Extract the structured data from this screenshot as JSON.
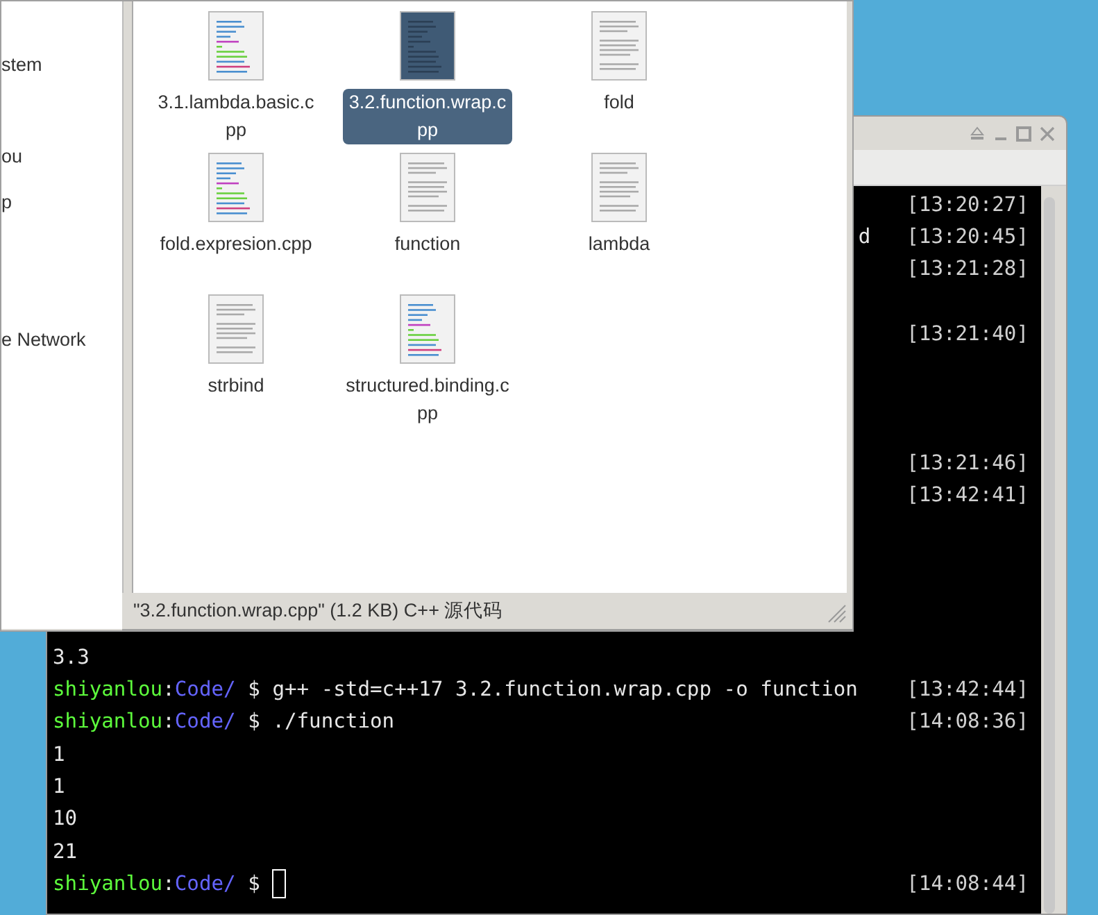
{
  "file_manager": {
    "sidebar": {
      "items": [
        {
          "kind": "place",
          "label": "stem"
        },
        {
          "kind": "blank"
        },
        {
          "kind": "place",
          "label": "ou"
        },
        {
          "kind": "place",
          "label": "p"
        },
        {
          "kind": "blank"
        },
        {
          "kind": "blank"
        },
        {
          "kind": "place",
          "label": "e Network"
        }
      ]
    },
    "files": [
      {
        "name": "3.1.lambda.basic.cpp",
        "kind": "code",
        "selected": false
      },
      {
        "name": "3.2.function.wrap.cpp",
        "kind": "code",
        "selected": true
      },
      {
        "name": "fold",
        "kind": "text",
        "selected": false
      },
      {
        "name": "fold.expresion.cpp",
        "kind": "code",
        "selected": false
      },
      {
        "name": "function",
        "kind": "text",
        "selected": false
      },
      {
        "name": "lambda",
        "kind": "text",
        "selected": false
      },
      {
        "name": "strbind",
        "kind": "text",
        "selected": false
      },
      {
        "name": "structured.binding.cpp",
        "kind": "code",
        "selected": false
      }
    ],
    "status_bar": "\"3.2.function.wrap.cpp\" (1.2 KB) C++ 源代码"
  },
  "terminal": {
    "lines": [
      {
        "kind": "output",
        "time": "[13:20:27]"
      },
      {
        "kind": "output",
        "tail": "d",
        "time": "[13:20:45]"
      },
      {
        "kind": "output",
        "time": "[13:21:28]"
      },
      {
        "kind": "blank"
      },
      {
        "kind": "output",
        "time": "[13:21:40]"
      },
      {
        "kind": "blank"
      },
      {
        "kind": "blank"
      },
      {
        "kind": "blank"
      },
      {
        "kind": "output",
        "time": "[13:21:46]"
      },
      {
        "kind": "output",
        "time": "[13:42:41]"
      },
      {
        "kind": "blank"
      },
      {
        "kind": "blank"
      },
      {
        "kind": "blank"
      },
      {
        "kind": "blank"
      },
      {
        "kind": "output",
        "text": "3.3"
      },
      {
        "kind": "prompt",
        "user": "shiyanlou",
        "separator": ":",
        "dir": "Code/",
        "symbol": "$",
        "command": "g++ -std=c++17 3.2.function.wrap.cpp -o function",
        "time": "[13:42:44]"
      },
      {
        "kind": "prompt",
        "user": "shiyanlou",
        "separator": ":",
        "dir": "Code/",
        "symbol": "$",
        "command": "./function",
        "time": "[14:08:36]"
      },
      {
        "kind": "output",
        "text": "1"
      },
      {
        "kind": "output",
        "text": "1"
      },
      {
        "kind": "output",
        "text": "10"
      },
      {
        "kind": "output",
        "text": "21"
      },
      {
        "kind": "prompt",
        "user": "shiyanlou",
        "separator": ":",
        "dir": "Code/",
        "symbol": "$",
        "cursor": true,
        "time": "[14:08:44]"
      }
    ]
  }
}
